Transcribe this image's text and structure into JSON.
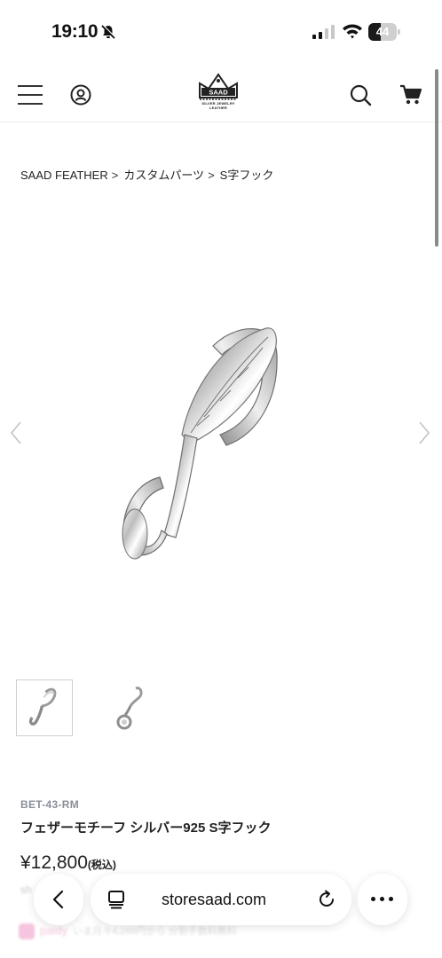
{
  "status_bar": {
    "time": "19:10",
    "battery_level": "44"
  },
  "header": {
    "logo_text": "SAAD",
    "logo_subtitle": "SILVER JEWELRY LEATHER"
  },
  "breadcrumb": [
    {
      "label": "SAAD FEATHER"
    },
    {
      "label": "カスタムパーツ"
    },
    {
      "label": "S字フック"
    }
  ],
  "breadcrumb_separator": ">",
  "product": {
    "sku": "BET-43-RM",
    "title": "フェザーモチーフ シルバー925 S字フック",
    "price": "¥12,800",
    "tax_note": "(税込)",
    "image_count": 2,
    "selected_thumbnail": 1
  },
  "share": {
    "label": "sh"
  },
  "paidy": {
    "brand": "paidy",
    "note": "いま月々4,266円から 分割手数料無料"
  },
  "browser": {
    "url": "storesaad.com"
  },
  "colors": {
    "sku_gray": "#8a8f98",
    "text": "#222222",
    "paidy_pink": "#e35aa3",
    "divider": "#ececec"
  },
  "icons": {
    "menu": "hamburger-icon",
    "user": "user-circle-icon",
    "search": "search-icon",
    "cart": "cart-icon",
    "prev": "chevron-left-icon",
    "next": "chevron-right-icon",
    "back": "back-chevron-icon",
    "tabs": "tabs-icon",
    "reload": "reload-icon",
    "more": "more-dots-icon"
  }
}
